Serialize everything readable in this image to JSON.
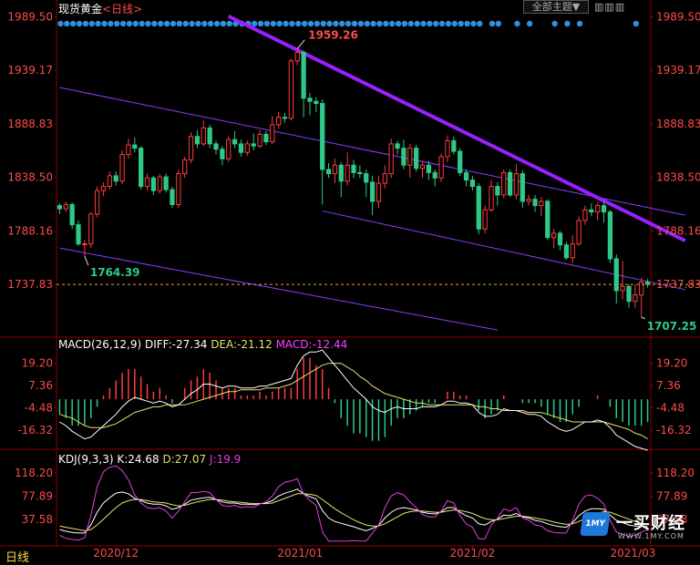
{
  "header": {
    "title": "现货黄金",
    "period_link": "<日线>",
    "theme_button": "全部主题▼",
    "tool_icons": "▥▥▥"
  },
  "colors": {
    "up": "#ff3b3b",
    "down": "#2ec989",
    "trend_main": "#9a1fff",
    "trend_thin": "#8c3cff",
    "diff": "#ffffff",
    "dea": "#e8e06a",
    "macd_label": "#ff40ff",
    "k": "#ffffff",
    "d": "#e8e06a",
    "j": "#e040e0",
    "grid": "#8b0000"
  },
  "chart_data": [
    {
      "type": "candlestick",
      "name": "price",
      "x_labels": [
        "2020/12",
        "2021/01",
        "2021/02",
        "2021/03"
      ],
      "y_ticks": [
        1989.5,
        1939.17,
        1888.83,
        1838.5,
        1788.16,
        1737.83
      ],
      "ylim": [
        1690,
        1995
      ],
      "current_price_line": 1737.83,
      "annotations": [
        {
          "text": "1959.26",
          "candle": 38,
          "value": 1959.26
        },
        {
          "text": "1764.39",
          "candle": 4,
          "value": 1764.39
        },
        {
          "text": "1707.25",
          "candle": 93,
          "value": 1707.25
        }
      ],
      "trendlines": {
        "main": {
          "from": [
            27,
            1990
          ],
          "to": [
            100,
            1779
          ]
        },
        "channel_upper": {
          "from": [
            0,
            1923
          ],
          "to": [
            100,
            1803
          ]
        },
        "channel_lower": {
          "from": [
            0,
            1772
          ],
          "to": [
            70,
            1695
          ]
        },
        "mid_upper": {
          "from": [
            42,
            1807
          ],
          "to": [
            100,
            1733
          ]
        }
      },
      "candles": [
        [
          1812,
          1809,
          1814,
          1804
        ],
        [
          1809,
          1813,
          1816,
          1806
        ],
        [
          1813,
          1794,
          1815,
          1790
        ],
        [
          1794,
          1776,
          1798,
          1774
        ],
        [
          1776,
          1776,
          1780,
          1764
        ],
        [
          1776,
          1804,
          1806,
          1772
        ],
        [
          1804,
          1826,
          1830,
          1801
        ],
        [
          1826,
          1830,
          1834,
          1821
        ],
        [
          1830,
          1840,
          1844,
          1827
        ],
        [
          1840,
          1835,
          1844,
          1831
        ],
        [
          1835,
          1860,
          1864,
          1832
        ],
        [
          1860,
          1869,
          1875,
          1856
        ],
        [
          1869,
          1866,
          1876,
          1862
        ],
        [
          1866,
          1830,
          1868,
          1827
        ],
        [
          1830,
          1838,
          1842,
          1826
        ],
        [
          1838,
          1826,
          1840,
          1822
        ],
        [
          1826,
          1839,
          1842,
          1823
        ],
        [
          1839,
          1827,
          1842,
          1824
        ],
        [
          1827,
          1813,
          1830,
          1810
        ],
        [
          1813,
          1842,
          1846,
          1810
        ],
        [
          1842,
          1855,
          1858,
          1838
        ],
        [
          1855,
          1877,
          1881,
          1852
        ],
        [
          1877,
          1870,
          1883,
          1866
        ],
        [
          1870,
          1885,
          1892,
          1868
        ],
        [
          1885,
          1870,
          1888,
          1866
        ],
        [
          1870,
          1865,
          1873,
          1860
        ],
        [
          1865,
          1856,
          1868,
          1850
        ],
        [
          1856,
          1874,
          1877,
          1853
        ],
        [
          1874,
          1870,
          1882,
          1866
        ],
        [
          1870,
          1862,
          1874,
          1858
        ],
        [
          1862,
          1870,
          1873,
          1859
        ],
        [
          1870,
          1868,
          1880,
          1864
        ],
        [
          1868,
          1879,
          1883,
          1866
        ],
        [
          1879,
          1872,
          1882,
          1869
        ],
        [
          1872,
          1888,
          1896,
          1870
        ],
        [
          1888,
          1895,
          1900,
          1884
        ],
        [
          1895,
          1894,
          1899,
          1890
        ],
        [
          1894,
          1948,
          1950,
          1892
        ],
        [
          1948,
          1956,
          1959,
          1944
        ],
        [
          1956,
          1913,
          1958,
          1895
        ],
        [
          1913,
          1910,
          1918,
          1897
        ],
        [
          1910,
          1908,
          1914,
          1900
        ],
        [
          1908,
          1846,
          1912,
          1813
        ],
        [
          1846,
          1842,
          1852,
          1838
        ],
        [
          1842,
          1850,
          1856,
          1833
        ],
        [
          1850,
          1835,
          1853,
          1820
        ],
        [
          1835,
          1850,
          1862,
          1831
        ],
        [
          1850,
          1843,
          1855,
          1838
        ],
        [
          1843,
          1842,
          1850,
          1838
        ],
        [
          1842,
          1834,
          1846,
          1820
        ],
        [
          1834,
          1816,
          1840,
          1803
        ],
        [
          1816,
          1833,
          1840,
          1810
        ],
        [
          1833,
          1842,
          1850,
          1828
        ],
        [
          1842,
          1870,
          1875,
          1838
        ],
        [
          1870,
          1866,
          1873,
          1860
        ],
        [
          1866,
          1850,
          1874,
          1846
        ],
        [
          1850,
          1866,
          1870,
          1838
        ],
        [
          1866,
          1847,
          1869,
          1844
        ],
        [
          1847,
          1850,
          1854,
          1838
        ],
        [
          1850,
          1843,
          1854,
          1836
        ],
        [
          1843,
          1838,
          1846,
          1830
        ],
        [
          1838,
          1858,
          1861,
          1834
        ],
        [
          1858,
          1873,
          1878,
          1853
        ],
        [
          1873,
          1863,
          1877,
          1860
        ],
        [
          1863,
          1843,
          1866,
          1840
        ],
        [
          1843,
          1836,
          1846,
          1830
        ],
        [
          1836,
          1830,
          1840,
          1826
        ],
        [
          1830,
          1790,
          1833,
          1785
        ],
        [
          1790,
          1808,
          1812,
          1786
        ],
        [
          1808,
          1830,
          1836,
          1806
        ],
        [
          1830,
          1822,
          1834,
          1812
        ],
        [
          1822,
          1843,
          1846,
          1819
        ],
        [
          1843,
          1822,
          1846,
          1820
        ],
        [
          1822,
          1842,
          1851,
          1818
        ],
        [
          1842,
          1816,
          1845,
          1810
        ],
        [
          1816,
          1818,
          1822,
          1812
        ],
        [
          1818,
          1812,
          1822,
          1806
        ],
        [
          1812,
          1816,
          1820,
          1802
        ],
        [
          1816,
          1782,
          1818,
          1780
        ],
        [
          1782,
          1786,
          1790,
          1772
        ],
        [
          1786,
          1775,
          1788,
          1770
        ],
        [
          1775,
          1763,
          1778,
          1761
        ],
        [
          1763,
          1776,
          1784,
          1758
        ],
        [
          1776,
          1798,
          1802,
          1774
        ],
        [
          1798,
          1808,
          1812,
          1794
        ],
        [
          1808,
          1806,
          1814,
          1802
        ],
        [
          1806,
          1812,
          1815,
          1798
        ],
        [
          1812,
          1806,
          1816,
          1796
        ],
        [
          1806,
          1762,
          1808,
          1758
        ],
        [
          1762,
          1732,
          1766,
          1720
        ],
        [
          1732,
          1736,
          1760,
          1724
        ],
        [
          1736,
          1722,
          1738,
          1716
        ],
        [
          1722,
          1728,
          1738,
          1716
        ],
        [
          1728,
          1740,
          1744,
          1707
        ],
        [
          1740,
          1738,
          1743,
          1735
        ]
      ]
    },
    {
      "type": "line+bar",
      "name": "macd",
      "label": "MACD(26,12,9)",
      "diff_label": "DIFF:",
      "diff": -27.34,
      "dea_label": "DEA:",
      "dea": -21.12,
      "macd_value_label": "MACD:",
      "macd": -12.44,
      "y_ticks": [
        19.2,
        7.36,
        -4.48,
        -16.32
      ],
      "ylim": [
        -26,
        29
      ],
      "diff_series": [
        -12,
        -14,
        -17,
        -19,
        -21,
        -20,
        -17,
        -14,
        -11,
        -8,
        -4,
        -1,
        1,
        0,
        -1,
        -2,
        -1,
        -2,
        -4,
        -3,
        0,
        3,
        5,
        8,
        8,
        7,
        6,
        7,
        7,
        6,
        6,
        6,
        7,
        7,
        8,
        9,
        10,
        11,
        18,
        23,
        25,
        25,
        26,
        22,
        18,
        14,
        10,
        6,
        3,
        0,
        -4,
        -6,
        -7,
        -5,
        -4,
        -5,
        -5,
        -5,
        -4,
        -4,
        -4,
        -3,
        -1,
        -1,
        -2,
        -2,
        -3,
        -7,
        -9,
        -9,
        -8,
        -5,
        -6,
        -6,
        -7,
        -8,
        -8,
        -9,
        -12,
        -14,
        -16,
        -17,
        -16,
        -14,
        -12,
        -12,
        -11,
        -12,
        -15,
        -19,
        -21,
        -23,
        -25,
        -26,
        -27
      ],
      "dea_series": [
        -8,
        -9,
        -10,
        -12,
        -14,
        -15,
        -15,
        -15,
        -14,
        -13,
        -11,
        -9,
        -7,
        -6,
        -5,
        -4,
        -4,
        -3,
        -3,
        -3,
        -3,
        -2,
        -1,
        0,
        1,
        2,
        3,
        4,
        4,
        5,
        5,
        5,
        5,
        6,
        6,
        6,
        7,
        8,
        10,
        12,
        14,
        16,
        18,
        19,
        19,
        19,
        17,
        15,
        12,
        10,
        7,
        5,
        3,
        2,
        1,
        0,
        -1,
        -2,
        -2,
        -3,
        -3,
        -3,
        -3,
        -3,
        -3,
        -3,
        -3,
        -4,
        -4,
        -5,
        -5,
        -6,
        -6,
        -6,
        -6,
        -7,
        -7,
        -7,
        -8,
        -9,
        -10,
        -11,
        -12,
        -12,
        -12,
        -12,
        -12,
        -12,
        -13,
        -14,
        -15,
        -16,
        -18,
        -19,
        -21
      ]
    },
    {
      "type": "line",
      "name": "kdj",
      "label": "KDJ(9,3,3)",
      "k_label": "K:",
      "k": 24.68,
      "d_label": "D:",
      "d": 27.07,
      "j_label": "J:",
      "j": 19.9,
      "y_ticks": [
        118.2,
        77.89,
        37.58
      ],
      "ylim": [
        -5,
        140
      ],
      "k_series": [
        20,
        17,
        15,
        14,
        14,
        28,
        50,
        66,
        75,
        83,
        85,
        82,
        74,
        70,
        66,
        64,
        64,
        61,
        55,
        58,
        64,
        71,
        73,
        75,
        76,
        72,
        68,
        66,
        66,
        64,
        64,
        63,
        65,
        66,
        70,
        78,
        83,
        86,
        90,
        82,
        77,
        73,
        53,
        40,
        34,
        31,
        28,
        25,
        21,
        18,
        22,
        27,
        40,
        50,
        56,
        58,
        56,
        54,
        50,
        48,
        47,
        51,
        58,
        58,
        50,
        44,
        40,
        30,
        28,
        34,
        38,
        45,
        44,
        48,
        42,
        40,
        36,
        34,
        30,
        27,
        25,
        24,
        32,
        44,
        52,
        56,
        56,
        55,
        45,
        36,
        32,
        28,
        26,
        26,
        25
      ],
      "d_series": [
        26,
        24,
        22,
        20,
        18,
        20,
        28,
        38,
        48,
        58,
        66,
        70,
        72,
        72,
        70,
        68,
        67,
        66,
        63,
        61,
        62,
        65,
        68,
        70,
        72,
        72,
        71,
        69,
        68,
        67,
        66,
        65,
        65,
        65,
        66,
        70,
        74,
        78,
        82,
        82,
        81,
        79,
        72,
        64,
        56,
        49,
        43,
        37,
        32,
        28,
        26,
        26,
        30,
        36,
        42,
        48,
        51,
        52,
        52,
        51,
        50,
        50,
        52,
        54,
        53,
        51,
        48,
        43,
        39,
        37,
        37,
        39,
        41,
        43,
        43,
        42,
        40,
        38,
        36,
        33,
        31,
        29,
        30,
        34,
        39,
        44,
        48,
        51,
        50,
        46,
        42,
        38,
        34,
        31,
        29
      ],
      "j_series": [
        10,
        5,
        3,
        2,
        6,
        44,
        94,
        120,
        128,
        130,
        122,
        106,
        80,
        66,
        58,
        56,
        58,
        52,
        40,
        52,
        68,
        84,
        84,
        86,
        84,
        72,
        62,
        60,
        62,
        58,
        60,
        58,
        64,
        68,
        78,
        94,
        102,
        104,
        108,
        82,
        70,
        62,
        16,
        0,
        0,
        0,
        0,
        1,
        0,
        0,
        14,
        28,
        58,
        78,
        84,
        80,
        68,
        58,
        46,
        42,
        42,
        52,
        70,
        66,
        44,
        30,
        24,
        4,
        4,
        28,
        40,
        56,
        52,
        58,
        40,
        36,
        28,
        26,
        18,
        15,
        14,
        14,
        36,
        64,
        78,
        80,
        74,
        64,
        36,
        16,
        12,
        8,
        10,
        16,
        20
      ]
    },
    {
      "type": "dots",
      "name": "signal-strip",
      "present": [
        1,
        1,
        1,
        1,
        1,
        1,
        1,
        1,
        1,
        1,
        1,
        1,
        1,
        1,
        1,
        1,
        1,
        1,
        1,
        1,
        1,
        1,
        1,
        1,
        1,
        1,
        1,
        1,
        1,
        1,
        1,
        1,
        1,
        1,
        1,
        1,
        1,
        1,
        1,
        1,
        1,
        1,
        1,
        1,
        1,
        1,
        1,
        1,
        1,
        1,
        1,
        1,
        1,
        1,
        1,
        1,
        1,
        1,
        1,
        1,
        1,
        1,
        1,
        1,
        1,
        1,
        1,
        1,
        0,
        1,
        1,
        0,
        0,
        1,
        0,
        1,
        0,
        0,
        0,
        1,
        0,
        1,
        0,
        1,
        0,
        0,
        0,
        0,
        0,
        0,
        0,
        0,
        1,
        0,
        0
      ]
    }
  ],
  "footer": {
    "period_tab": "日线",
    "logo_badge": "1MY",
    "logo_name": "一买财经",
    "logo_url": "WWW.1MY.COM"
  }
}
